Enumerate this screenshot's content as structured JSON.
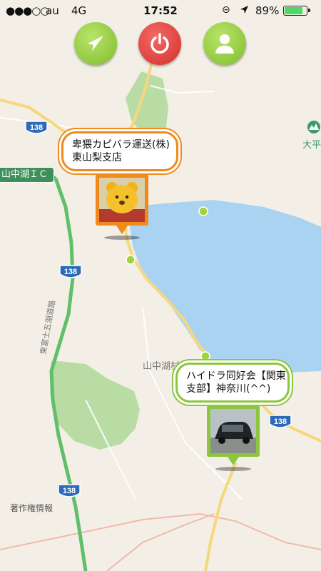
{
  "status_bar": {
    "signal": "●●●○○",
    "carrier": "au",
    "network": "4G",
    "time": "17:52",
    "battery_percent": "89%",
    "battery_level": 0.89
  },
  "toolbar": {
    "locate_button": "location-arrow-icon",
    "power_button": "power-icon",
    "profile_button": "person-icon"
  },
  "map": {
    "route_shield": "138",
    "interchange_label": "山中湖ＩＣ",
    "road_name": "東富士五湖道路",
    "lake_area_label": "山中湖村",
    "area_label_right": "大平",
    "credit": "著作権情報"
  },
  "callouts": [
    {
      "line1": "卑猥カピバラ運送(株)",
      "line2": "東山梨支店",
      "border_color": "#f08a1c",
      "photo": "yellow bear plush"
    },
    {
      "line1": "ハイドラ同好会【関東",
      "line2": "支部】神奈川(^^)",
      "border_color": "#8cc63f",
      "photo": "dark car"
    }
  ],
  "colors": {
    "water": "#a9d3f1",
    "park": "#b9dca4",
    "expressway": "#5fbf6a",
    "major_road": "#f6d77d",
    "orange_pin": "#f08a1c",
    "green_pin": "#8cc63f",
    "red_button": "#e8403d"
  }
}
